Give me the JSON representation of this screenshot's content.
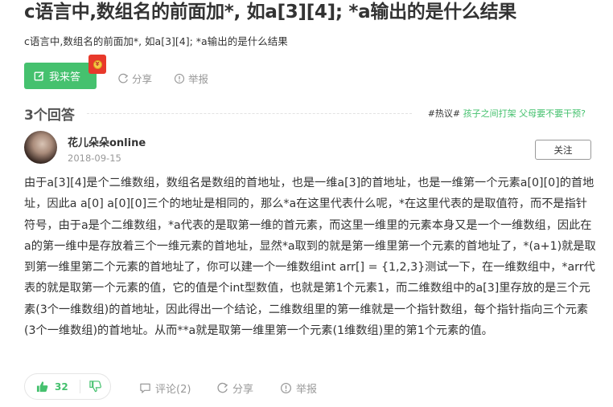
{
  "question": {
    "title": "c语言中,数组名的前面加*, 如a[3][4]; *a输出的是什么结果",
    "subtitle": "c语言中,数组名的前面加*, 如a[3][4]; *a输出的是什么结果"
  },
  "actions": {
    "answer_label": "我来答",
    "share_label": "分享",
    "report_label": "举报"
  },
  "answers_header": {
    "count_label": "3个回答",
    "hot_tag": "#热议#",
    "hot_topic": "孩子之间打架 父母要不要干预?"
  },
  "answer": {
    "username": "花儿朵朵online",
    "date": "2018-09-15",
    "follow_label": "关注",
    "text": "由于a[3][4]是个二维数组，数组名是数组的首地址，也是一维a[3]的首地址，也是一维第一个元素a[0][0]的首地址，因此a a[0] a[0][0]三个的地址是相同的，那么*a在这里代表什么呢，*在这里代表的是取值符，而不是指针符号，由于a是个二维数组，*a代表的是取第一维的首元素，而这里一维里的元素本身又是一个一维数组，因此在a的第一维中是存放着三个一维元素的首地址，显然*a取到的就是第一维里第一个元素的首地址了，*(a+1)就是取到第一维里第二个元素的首地址了，你可以建一个一维数组int arr[] = {1,2,3}测试一下，在一维数组中，*arr代表的就是取第一个元素的值，它的值是个int型数值，也就是第1个元素1，而二维数组中的a[3]里存放的是三个元素(3个一维数组)的首地址，因此得出一个结论，二维数组里的第一维就是一个指针数组，每个指针指向三个元素(3个一维数组)的首地址。从而**a就是取第一维里第一个元素(1维数组)里的第1个元素的值。",
    "likes": "32",
    "comments_label": "评论(2)",
    "share_label": "分享",
    "report_label": "举报"
  },
  "colors": {
    "brand_green": "#45c16e",
    "muted_gray": "#999999",
    "text": "#333333"
  },
  "icons": {
    "answer": "edit-icon",
    "share": "share-icon",
    "report": "report-icon",
    "like": "thumbs-up-icon",
    "dislike": "thumbs-down-icon",
    "comment": "comment-icon"
  }
}
